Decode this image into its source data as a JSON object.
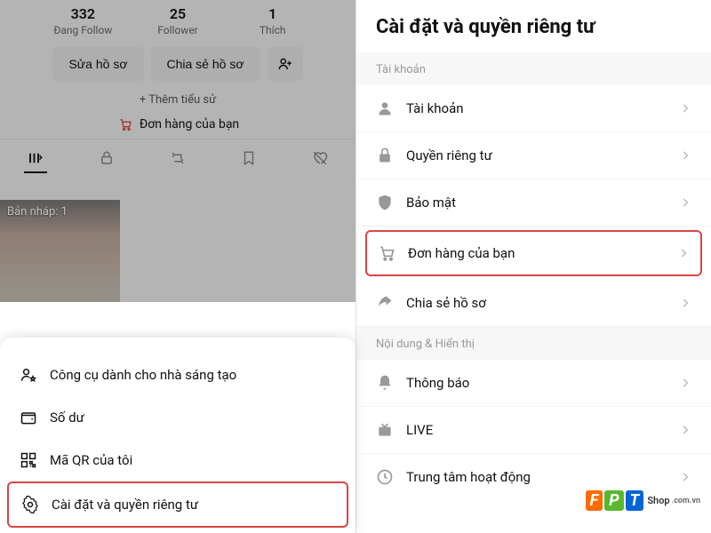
{
  "left": {
    "stats": [
      {
        "value": "332",
        "label": "Đang Follow"
      },
      {
        "value": "25",
        "label": "Follower"
      },
      {
        "value": "1",
        "label": "Thích"
      }
    ],
    "edit_profile": "Sửa hồ sơ",
    "share_profile": "Chia sẻ hồ sơ",
    "add_bio": "+ Thêm tiểu sử",
    "orders_link": "Đơn hàng của bạn",
    "draft_label": "Bản nháp: 1",
    "sheet": {
      "creator_tools": "Công cụ dành cho nhà sáng tạo",
      "balance": "Số dư",
      "my_qr": "Mã QR của tôi",
      "settings": "Cài đặt và quyền riêng tư"
    }
  },
  "right": {
    "title": "Cài đặt và quyền riêng tư",
    "section_account": "Tài khoản",
    "section_content": "Nội dung & Hiển thị",
    "items": {
      "account": "Tài khoản",
      "privacy": "Quyền riêng tư",
      "security": "Bảo mật",
      "orders": "Đơn hàng của bạn",
      "share": "Chia sẻ hồ sơ",
      "notifications": "Thông báo",
      "live": "LIVE",
      "activity": "Trung tâm hoạt động"
    }
  },
  "watermark": {
    "shop": "Shop",
    "domain": ".com.vn"
  }
}
